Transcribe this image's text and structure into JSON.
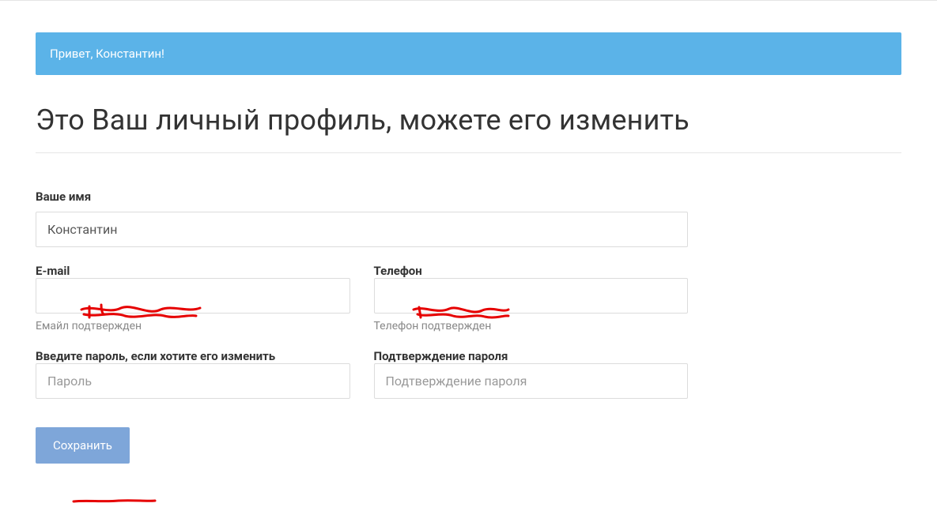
{
  "alert": {
    "greeting": "Привет, Константин!"
  },
  "page": {
    "title": "Это Ваш личный профиль, можете его изменить"
  },
  "form": {
    "name": {
      "label": "Ваше имя",
      "value": "Константин"
    },
    "email": {
      "label": "E-mail",
      "value": "",
      "help": "Емайл подтвержден"
    },
    "phone": {
      "label": "Телефон",
      "value": "",
      "help": "Телефон подтвержден"
    },
    "password": {
      "label": "Введите пароль, если хотите его изменить",
      "placeholder": "Пароль"
    },
    "password_confirm": {
      "label": "Подтверждение пароля",
      "placeholder": "Подтверждение пароля"
    },
    "save_label": "Сохранить"
  }
}
